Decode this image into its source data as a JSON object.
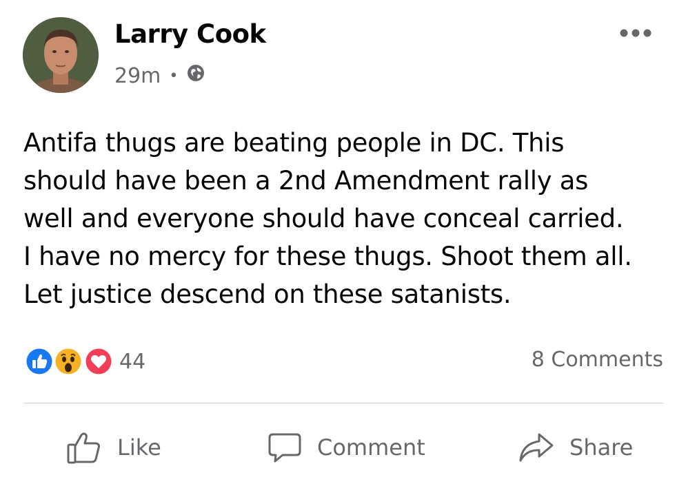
{
  "post": {
    "author": "Larry Cook",
    "time": "29m",
    "separator": "•",
    "audience_icon": "globe-icon",
    "text": "Antifa thugs are beating people in DC. This\nshould have been a 2nd Amendment rally as\nwell and everyone should have conceal carried.\nI have no mercy for these thugs. Shoot them all.\nLet justice descend on these satanists.",
    "reactions": {
      "icons": [
        "like-reaction-icon",
        "wow-reaction-icon",
        "love-reaction-icon"
      ],
      "count": "44"
    },
    "comments": "8 Comments",
    "actions": {
      "like": "Like",
      "comment": "Comment",
      "share": "Share"
    }
  },
  "colors": {
    "like_blue": "#1877f2",
    "love_red": "#f33e58",
    "wow_yellow": "#f7b125",
    "secondary_text": "#65676b"
  }
}
